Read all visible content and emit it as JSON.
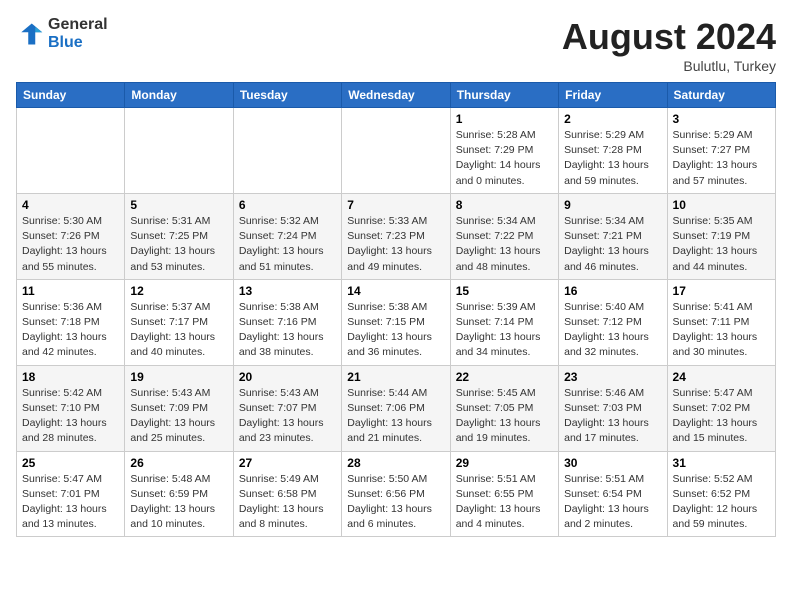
{
  "logo": {
    "line1": "General",
    "line2": "Blue"
  },
  "title": "August 2024",
  "subtitle": "Bulutlu, Turkey",
  "weekdays": [
    "Sunday",
    "Monday",
    "Tuesday",
    "Wednesday",
    "Thursday",
    "Friday",
    "Saturday"
  ],
  "weeks": [
    [
      {
        "day": "",
        "info": ""
      },
      {
        "day": "",
        "info": ""
      },
      {
        "day": "",
        "info": ""
      },
      {
        "day": "",
        "info": ""
      },
      {
        "day": "1",
        "info": "Sunrise: 5:28 AM\nSunset: 7:29 PM\nDaylight: 14 hours\nand 0 minutes."
      },
      {
        "day": "2",
        "info": "Sunrise: 5:29 AM\nSunset: 7:28 PM\nDaylight: 13 hours\nand 59 minutes."
      },
      {
        "day": "3",
        "info": "Sunrise: 5:29 AM\nSunset: 7:27 PM\nDaylight: 13 hours\nand 57 minutes."
      }
    ],
    [
      {
        "day": "4",
        "info": "Sunrise: 5:30 AM\nSunset: 7:26 PM\nDaylight: 13 hours\nand 55 minutes."
      },
      {
        "day": "5",
        "info": "Sunrise: 5:31 AM\nSunset: 7:25 PM\nDaylight: 13 hours\nand 53 minutes."
      },
      {
        "day": "6",
        "info": "Sunrise: 5:32 AM\nSunset: 7:24 PM\nDaylight: 13 hours\nand 51 minutes."
      },
      {
        "day": "7",
        "info": "Sunrise: 5:33 AM\nSunset: 7:23 PM\nDaylight: 13 hours\nand 49 minutes."
      },
      {
        "day": "8",
        "info": "Sunrise: 5:34 AM\nSunset: 7:22 PM\nDaylight: 13 hours\nand 48 minutes."
      },
      {
        "day": "9",
        "info": "Sunrise: 5:34 AM\nSunset: 7:21 PM\nDaylight: 13 hours\nand 46 minutes."
      },
      {
        "day": "10",
        "info": "Sunrise: 5:35 AM\nSunset: 7:19 PM\nDaylight: 13 hours\nand 44 minutes."
      }
    ],
    [
      {
        "day": "11",
        "info": "Sunrise: 5:36 AM\nSunset: 7:18 PM\nDaylight: 13 hours\nand 42 minutes."
      },
      {
        "day": "12",
        "info": "Sunrise: 5:37 AM\nSunset: 7:17 PM\nDaylight: 13 hours\nand 40 minutes."
      },
      {
        "day": "13",
        "info": "Sunrise: 5:38 AM\nSunset: 7:16 PM\nDaylight: 13 hours\nand 38 minutes."
      },
      {
        "day": "14",
        "info": "Sunrise: 5:38 AM\nSunset: 7:15 PM\nDaylight: 13 hours\nand 36 minutes."
      },
      {
        "day": "15",
        "info": "Sunrise: 5:39 AM\nSunset: 7:14 PM\nDaylight: 13 hours\nand 34 minutes."
      },
      {
        "day": "16",
        "info": "Sunrise: 5:40 AM\nSunset: 7:12 PM\nDaylight: 13 hours\nand 32 minutes."
      },
      {
        "day": "17",
        "info": "Sunrise: 5:41 AM\nSunset: 7:11 PM\nDaylight: 13 hours\nand 30 minutes."
      }
    ],
    [
      {
        "day": "18",
        "info": "Sunrise: 5:42 AM\nSunset: 7:10 PM\nDaylight: 13 hours\nand 28 minutes."
      },
      {
        "day": "19",
        "info": "Sunrise: 5:43 AM\nSunset: 7:09 PM\nDaylight: 13 hours\nand 25 minutes."
      },
      {
        "day": "20",
        "info": "Sunrise: 5:43 AM\nSunset: 7:07 PM\nDaylight: 13 hours\nand 23 minutes."
      },
      {
        "day": "21",
        "info": "Sunrise: 5:44 AM\nSunset: 7:06 PM\nDaylight: 13 hours\nand 21 minutes."
      },
      {
        "day": "22",
        "info": "Sunrise: 5:45 AM\nSunset: 7:05 PM\nDaylight: 13 hours\nand 19 minutes."
      },
      {
        "day": "23",
        "info": "Sunrise: 5:46 AM\nSunset: 7:03 PM\nDaylight: 13 hours\nand 17 minutes."
      },
      {
        "day": "24",
        "info": "Sunrise: 5:47 AM\nSunset: 7:02 PM\nDaylight: 13 hours\nand 15 minutes."
      }
    ],
    [
      {
        "day": "25",
        "info": "Sunrise: 5:47 AM\nSunset: 7:01 PM\nDaylight: 13 hours\nand 13 minutes."
      },
      {
        "day": "26",
        "info": "Sunrise: 5:48 AM\nSunset: 6:59 PM\nDaylight: 13 hours\nand 10 minutes."
      },
      {
        "day": "27",
        "info": "Sunrise: 5:49 AM\nSunset: 6:58 PM\nDaylight: 13 hours\nand 8 minutes."
      },
      {
        "day": "28",
        "info": "Sunrise: 5:50 AM\nSunset: 6:56 PM\nDaylight: 13 hours\nand 6 minutes."
      },
      {
        "day": "29",
        "info": "Sunrise: 5:51 AM\nSunset: 6:55 PM\nDaylight: 13 hours\nand 4 minutes."
      },
      {
        "day": "30",
        "info": "Sunrise: 5:51 AM\nSunset: 6:54 PM\nDaylight: 13 hours\nand 2 minutes."
      },
      {
        "day": "31",
        "info": "Sunrise: 5:52 AM\nSunset: 6:52 PM\nDaylight: 12 hours\nand 59 minutes."
      }
    ]
  ]
}
